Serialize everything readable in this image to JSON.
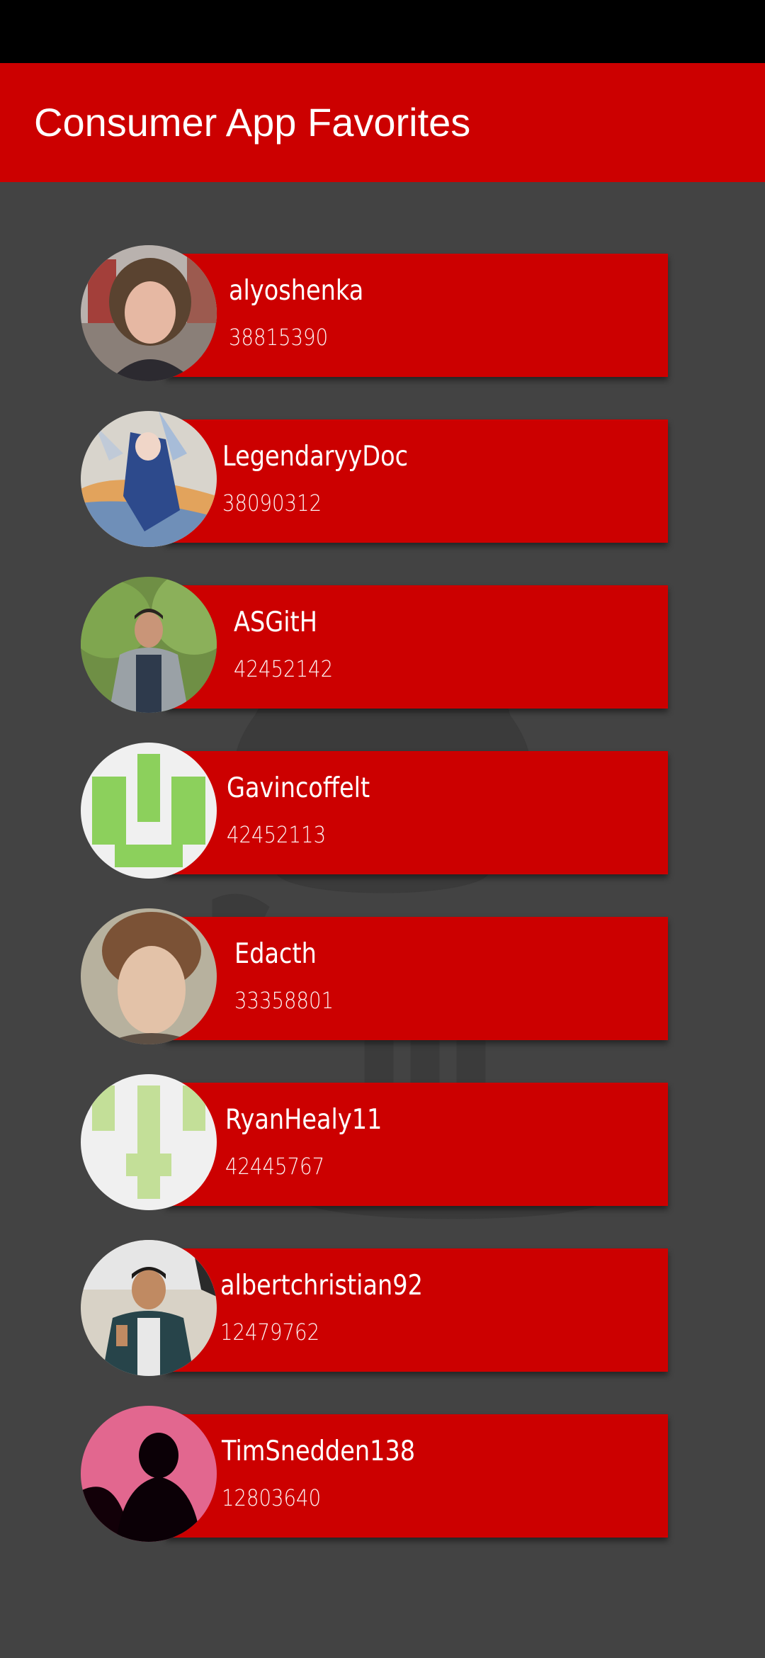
{
  "app_bar": {
    "title": "Consumer App Favorites"
  },
  "colors": {
    "accent": "#cc0000",
    "background": "#434343",
    "status_bar": "#000000",
    "text": "#ffffff"
  },
  "favorites": [
    {
      "username": "alyoshenka",
      "id": "38815390",
      "avatar": "profile-photo"
    },
    {
      "username": "LegendaryyDoc",
      "id": "38090312",
      "avatar": "anime-art"
    },
    {
      "username": "ASGitH",
      "id": "42452142",
      "avatar": "profile-photo"
    },
    {
      "username": "Gavincoffelt",
      "id": "42452113",
      "avatar": "identicon-green"
    },
    {
      "username": "Edacth",
      "id": "33358801",
      "avatar": "profile-photo"
    },
    {
      "username": "RyanHealy11",
      "id": "42445767",
      "avatar": "identicon-light-green"
    },
    {
      "username": "albertchristian92",
      "id": "12479762",
      "avatar": "profile-photo"
    },
    {
      "username": "TimSnedden138",
      "id": "12803640",
      "avatar": "silhouette-pink"
    }
  ]
}
